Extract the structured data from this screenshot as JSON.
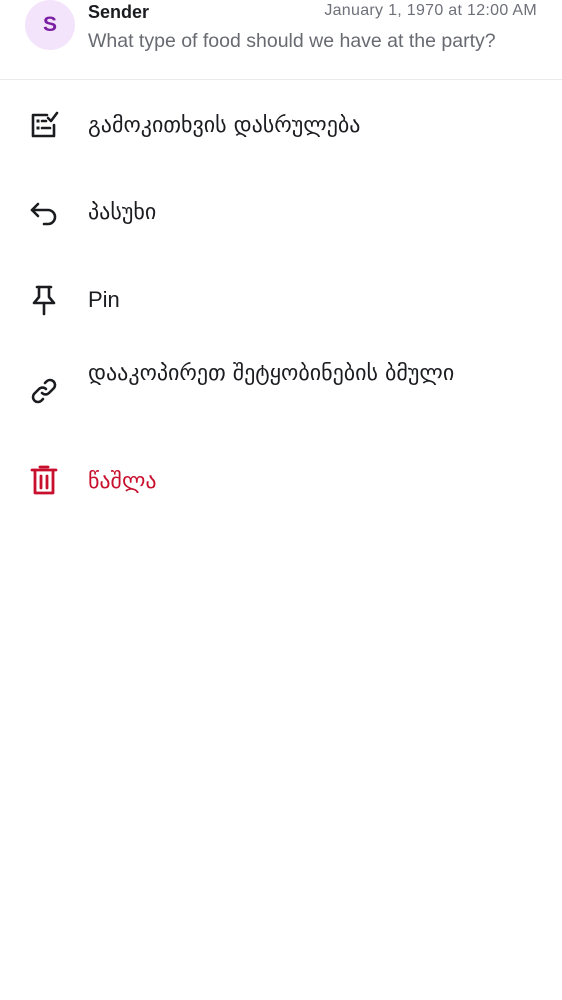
{
  "message": {
    "avatar_letter": "S",
    "sender": "Sender",
    "timestamp": "January 1, 1970 at 12:00 AM",
    "preview": "What type of food should we have at the party?"
  },
  "menu": {
    "items": [
      {
        "label": "გამოკითხვის დასრულება",
        "icon": "poll-end-icon"
      },
      {
        "label": "პასუხი",
        "icon": "reply-icon"
      },
      {
        "label": "Pin",
        "icon": "pin-icon"
      },
      {
        "label": "დააკოპირეთ შეტყობინების ბმული",
        "icon": "link-icon"
      },
      {
        "label": "წაშლა",
        "icon": "trash-icon",
        "color": "#c8102e"
      }
    ]
  }
}
